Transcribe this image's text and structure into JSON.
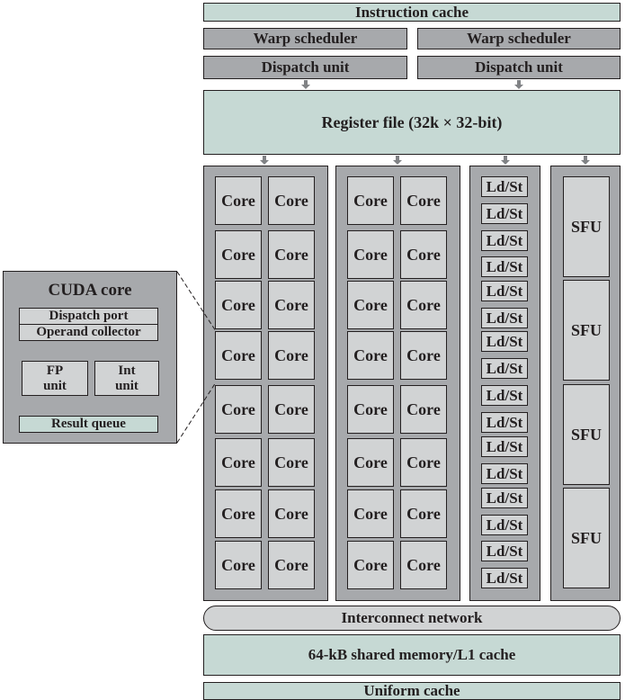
{
  "top": {
    "instruction_cache": "Instruction cache",
    "warp_schedulers": [
      "Warp scheduler",
      "Warp scheduler"
    ],
    "dispatch_units": [
      "Dispatch unit",
      "Dispatch unit"
    ],
    "register_file": "Register file (32k × 32-bit)"
  },
  "core_label": "Core",
  "ldst_label": "Ld/St",
  "sfu_label": "SFU",
  "bottom": {
    "interconnect": "Interconnect network",
    "shared_memory": "64-kB shared memory/L1 cache",
    "uniform_cache": "Uniform cache"
  },
  "cuda_core": {
    "title": "CUDA core",
    "dispatch_port": "Dispatch port",
    "operand_collector": "Operand collector",
    "fp_unit": [
      "FP",
      "unit"
    ],
    "int_unit": [
      "Int",
      "unit"
    ],
    "result_queue": "Result queue"
  },
  "counts": {
    "core_rows": 8,
    "cores_per_row_per_column": 2,
    "core_columns": 2,
    "ldst_units": 16,
    "sfu_units": 4
  }
}
